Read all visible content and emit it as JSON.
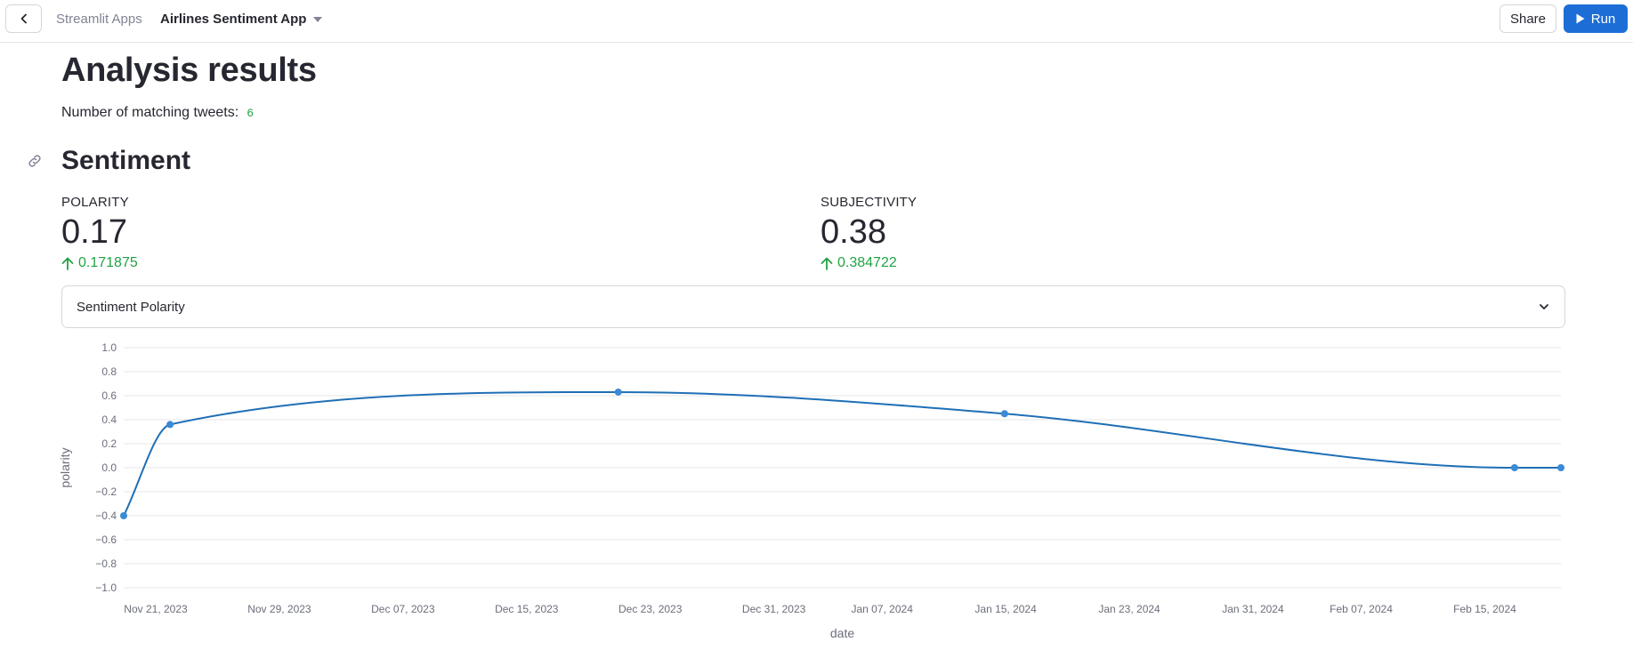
{
  "topbar": {
    "apps_label": "Streamlit Apps",
    "app_name": "Airlines Sentiment App",
    "share_label": "Share",
    "run_label": "Run"
  },
  "main": {
    "title": "Analysis results",
    "matching_label": "Number of matching tweets:",
    "matching_count": "6",
    "section_title": "Sentiment",
    "metrics": [
      {
        "label": "POLARITY",
        "value": "0.17",
        "delta": "0.171875"
      },
      {
        "label": "SUBJECTIVITY",
        "value": "0.38",
        "delta": "0.384722"
      }
    ],
    "select": {
      "value": "Sentiment Polarity"
    }
  },
  "colors": {
    "accent": "#1c6ed6",
    "line": "#1f6fb6",
    "point": "#3b8ad6",
    "positive": "#21a345"
  },
  "chart_data": {
    "type": "line",
    "xlabel": "date",
    "ylabel": "polarity",
    "ylim": [
      -1.0,
      1.0
    ],
    "yticks": [
      1.0,
      0.8,
      0.6,
      0.4,
      0.2,
      0.0,
      -0.2,
      -0.4,
      -0.6,
      -0.8,
      -1.0
    ],
    "ytick_labels": [
      "1.0",
      "0.8",
      "0.6",
      "0.4",
      "0.2",
      "0.0",
      "−0.2",
      "−0.4",
      "−0.6",
      "−0.8",
      "−1.0"
    ],
    "xlim": [
      "2023-11-21",
      "2024-02-22"
    ],
    "xticks": [
      {
        "date": "2023-11-21",
        "label": "Nov 21, 2023"
      },
      {
        "date": "2023-11-29",
        "label": "Nov 29, 2023"
      },
      {
        "date": "2023-12-07",
        "label": "Dec 07, 2023"
      },
      {
        "date": "2023-12-15",
        "label": "Dec 15, 2023"
      },
      {
        "date": "2023-12-23",
        "label": "Dec 23, 2023"
      },
      {
        "date": "2023-12-31",
        "label": "Dec 31, 2023"
      },
      {
        "date": "2024-01-07",
        "label": "Jan 07, 2024"
      },
      {
        "date": "2024-01-15",
        "label": "Jan 15, 2024"
      },
      {
        "date": "2024-01-23",
        "label": "Jan 23, 2024"
      },
      {
        "date": "2024-01-31",
        "label": "Jan 31, 2024"
      },
      {
        "date": "2024-02-07",
        "label": "Feb 07, 2024"
      },
      {
        "date": "2024-02-15",
        "label": "Feb 15, 2024"
      }
    ],
    "points": [
      {
        "x": "2023-11-21",
        "y": -0.4
      },
      {
        "x": "2023-11-24",
        "y": 0.36
      },
      {
        "x": "2023-12-23",
        "y": 0.63
      },
      {
        "x": "2024-01-17",
        "y": 0.45
      },
      {
        "x": "2024-02-19",
        "y": 0.0
      },
      {
        "x": "2024-02-22",
        "y": 0.0
      }
    ],
    "grid": true
  }
}
